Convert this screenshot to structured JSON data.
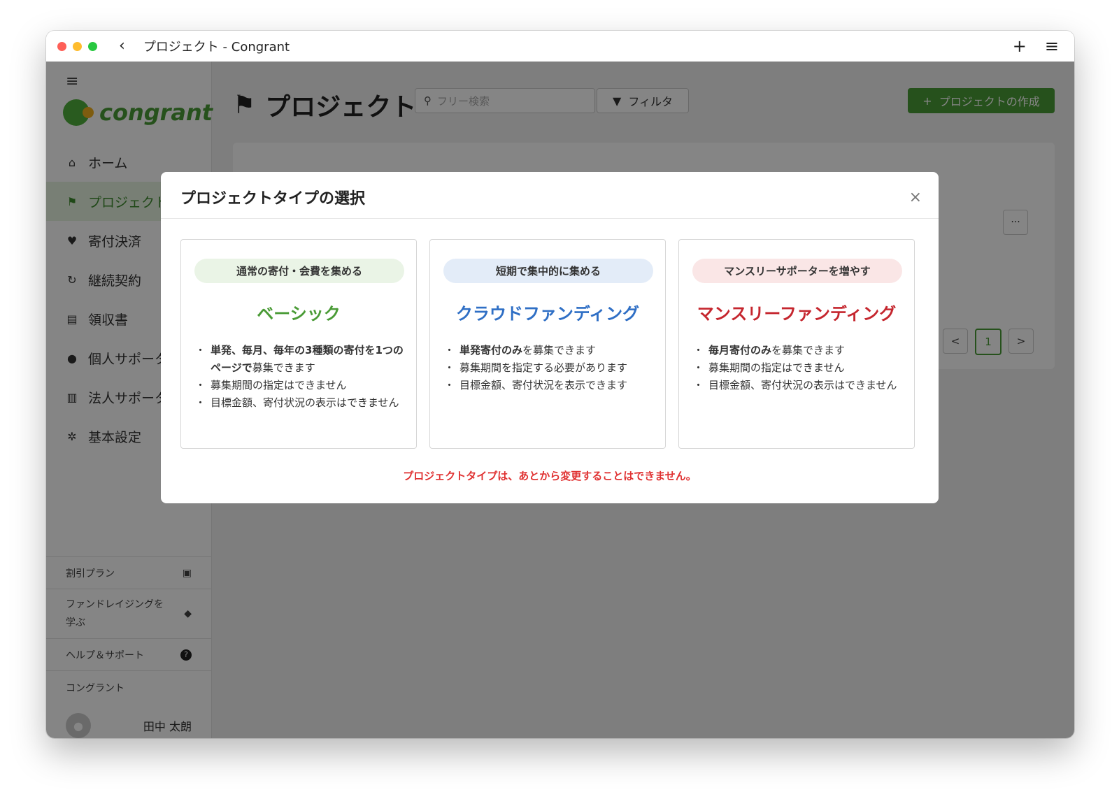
{
  "window": {
    "title": "プロジェクト - Congrant"
  },
  "sidebar": {
    "logo_text": "congrant",
    "items": [
      {
        "label": "ホーム",
        "icon": "home-icon",
        "glyph": "⌂"
      },
      {
        "label": "プロジェクト",
        "icon": "flag-icon",
        "glyph": "⚑"
      },
      {
        "label": "寄付決済",
        "icon": "heart-icon",
        "glyph": "♥"
      },
      {
        "label": "継続契約",
        "icon": "refresh-icon",
        "glyph": "↻"
      },
      {
        "label": "領収書",
        "icon": "document-icon",
        "glyph": "▤"
      },
      {
        "label": "個人サポーター",
        "icon": "person-icon",
        "glyph": "●"
      },
      {
        "label": "法人サポーター",
        "icon": "building-icon",
        "glyph": "▥"
      },
      {
        "label": "基本設定",
        "icon": "gear-icon",
        "glyph": "✲"
      }
    ],
    "discount_plan": "割引プラン",
    "learn_line1": "ファンドレイジングを",
    "learn_line2": "学ぶ",
    "help": "ヘルプ＆サポート",
    "org_name": "コングラント",
    "user_name": "田中 太朗"
  },
  "main": {
    "page_title": "プロジェクト",
    "search_placeholder": "フリー検索",
    "filter_label": "フィルタ",
    "create_label": "プロジェクトの作成",
    "more_label": "···",
    "pager_current": "1",
    "pager_next": ">",
    "pager_prev": "<"
  },
  "modal": {
    "title": "プロジェクトタイプの選択",
    "close": "×",
    "warning": "プロジェクトタイプは、あとから変更することはできません。",
    "cards": [
      {
        "pill": "通常の寄付・会費を集める",
        "name": "ベーシック",
        "f1_bold": "単発、毎月、毎年の3種類の寄付を1つのページで",
        "f1_rest": "募集できます",
        "f2": "募集期間の指定はできません",
        "f3": "目標金額、寄付状況の表示はできません"
      },
      {
        "pill": "短期で集中的に集める",
        "name": "クラウドファンディング",
        "f1_bold": "単発寄付のみ",
        "f1_rest": "を募集できます",
        "f2": "募集期間を指定する必要があります",
        "f3": "目標金額、寄付状況を表示できます"
      },
      {
        "pill": "マンスリーサポーターを増やす",
        "name": "マンスリーファンディング",
        "f1_bold": "毎月寄付のみ",
        "f1_rest": "を募集できます",
        "f2": "募集期間の指定はできません",
        "f3": "目標金額、寄付状況の表示はできません"
      }
    ]
  },
  "colors": {
    "brand_green": "#4a9b36",
    "crowd_blue": "#2f6fc5",
    "monthly_red": "#c5262e",
    "warning_red": "#e03232"
  }
}
